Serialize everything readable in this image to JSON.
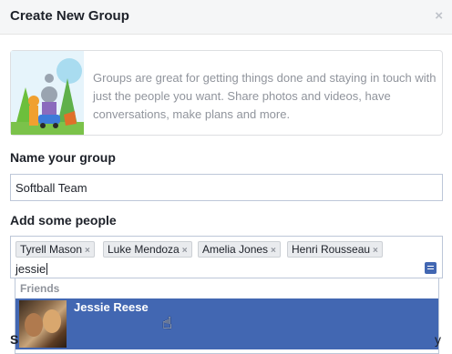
{
  "dialog": {
    "title": "Create New Group",
    "close_glyph": "×"
  },
  "intro": {
    "text": "Groups are great for getting things done and staying in touch with just the people you want. Share photos and videos, have conversations, make plans and more."
  },
  "name_section": {
    "label": "Name your group",
    "value": "Softball Team"
  },
  "people_section": {
    "label": "Add some people",
    "tokens": [
      {
        "name": "Tyrell Mason"
      },
      {
        "name": "Luke Mendoza"
      },
      {
        "name": "Amelia Jones"
      },
      {
        "name": "Henri Rousseau"
      }
    ],
    "token_remove_glyph": "×",
    "typed_text": "jessie",
    "composer_icon": "message-composer-icon"
  },
  "suggestions": {
    "section_label": "Friends",
    "items": [
      {
        "name": "Jessie Reese",
        "highlighted": true
      }
    ]
  },
  "colors": {
    "accent": "#4267b2",
    "header_bg": "#f5f6f7",
    "muted_text": "#90949c"
  }
}
